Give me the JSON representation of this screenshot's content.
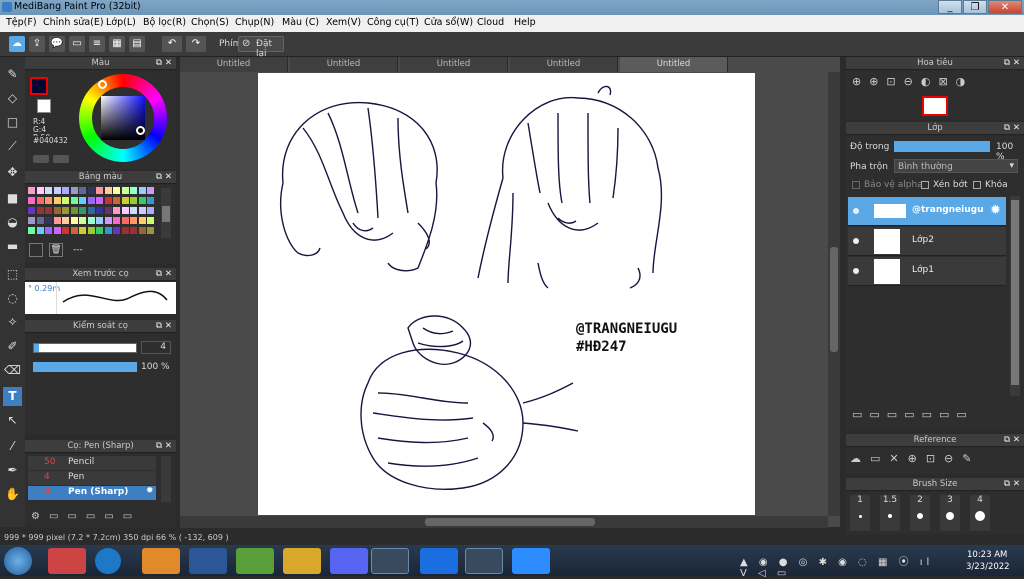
{
  "window": {
    "title": "MediBang Paint Pro (32bit)",
    "controls": [
      "_",
      "❐",
      "✕"
    ]
  },
  "menu": [
    "Tệp(F)",
    "Chỉnh sửa(E)",
    "Lớp(L)",
    "Bộ lọc(R)",
    "Chọn(S)",
    "Chụp(N)",
    "Màu (C)",
    "Xem(V)",
    "Công cụ(T)",
    "Cửa sổ(W)",
    "Cloud",
    "Help"
  ],
  "toolbar": {
    "key_label": "Phím",
    "reset_label": "Đặt lại"
  },
  "tabs": [
    "Untitled",
    "Untitled",
    "Untitled",
    "Untitled",
    "Untitled"
  ],
  "color_panel": {
    "title": "Màu",
    "r": "R:4",
    "g": "G:4",
    "b": "B:50",
    "hex": "#040432"
  },
  "palette_panel": {
    "title": "Bảng màu",
    "more": "---"
  },
  "preview_panel": {
    "title": "Xem trước cọ",
    "size": "0.29m"
  },
  "control_panel": {
    "title": "Kiểm soát cọ",
    "size_value": "4",
    "opacity_value": "100 %"
  },
  "brush_panel": {
    "title": "Cọ: Pen (Sharp)",
    "items": [
      {
        "num": "50",
        "name": "Pencil"
      },
      {
        "num": "4",
        "name": "Pen"
      },
      {
        "num": "4",
        "name": "Pen (Sharp)"
      }
    ]
  },
  "navigator": {
    "title": "Hoa tiêu"
  },
  "layer_panel": {
    "title": "Lớp",
    "opacity_label": "Độ trong",
    "opacity_value": "100 %",
    "blend_label": "Pha trộn",
    "blend_value": "Bình thường",
    "protect_alpha": "Bảo vệ alpha",
    "clipping": "Xén bớt",
    "lock": "Khóa",
    "layers": [
      "@trangneiugu",
      "Lớp2",
      "Lớp1"
    ]
  },
  "reference": {
    "title": "Reference"
  },
  "brush_size": {
    "title": "Brush Size",
    "sizes": [
      "1",
      "1.5",
      "2",
      "3",
      "4"
    ]
  },
  "canvas_text": {
    "handle": "@TRANGNEIUGU",
    "tag": "#HĐ247"
  },
  "status": {
    "text": "999 * 999 pixel  (7.2 * 7.2cm)  350 dpi  66 %  ( -132, 609 )"
  },
  "clock": {
    "time": "10:23 AM",
    "date": "3/23/2022"
  },
  "colors": {
    "foreground": "#040432",
    "accent": "#5aa9e6"
  }
}
